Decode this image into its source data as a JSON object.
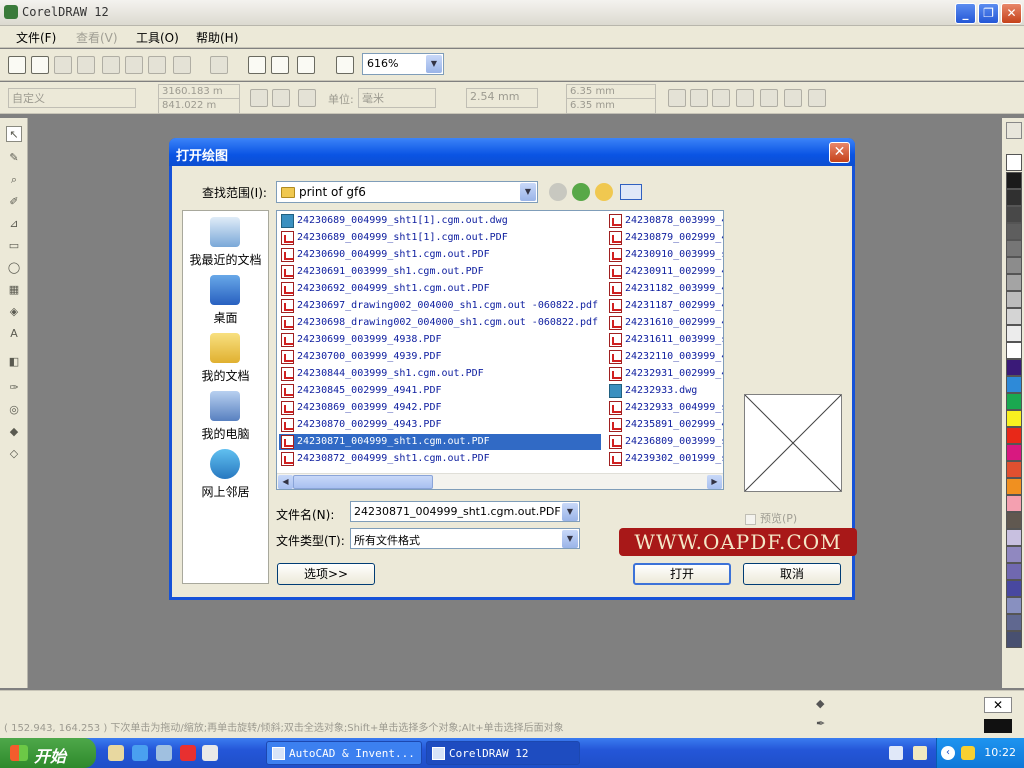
{
  "app": {
    "title": "CorelDRAW 12"
  },
  "menu": [
    "文件(F)",
    "查看(V)",
    "工具(O)",
    "帮助(H)"
  ],
  "toolbar": {
    "zoom": "616%"
  },
  "propbar": {
    "preset": "自定义",
    "width": "3160.183 m",
    "height": "841.022 m",
    "unit_label": "单位:",
    "unit": "毫米",
    "nudge": "2.54 mm",
    "dup_x": "6.35 mm",
    "dup_y": "6.35 mm"
  },
  "status": {
    "text": "( 152.943, 164.253 )  下次单击为拖动/缩放;再单击旋转/倾斜;双击全选对象;Shift+单击选择多个对象;Alt+单击选择后面对象"
  },
  "dialog": {
    "title": "打开绘图",
    "lookin_label": "查找范围(I):",
    "lookin_value": "print of gf6",
    "places": [
      "我最近的文档",
      "桌面",
      "我的文档",
      "我的电脑",
      "网上邻居"
    ],
    "files_col1": [
      {
        "name": "24230689_004999_sht1[1].cgm.out.dwg",
        "type": "dwg"
      },
      {
        "name": "24230689_004999_sht1[1].cgm.out.PDF",
        "type": "pdf"
      },
      {
        "name": "24230690_004999_sht1.cgm.out.PDF",
        "type": "pdf"
      },
      {
        "name": "24230691_003999_sh1.cgm.out.PDF",
        "type": "pdf"
      },
      {
        "name": "24230692_004999_sht1.cgm.out.PDF",
        "type": "pdf"
      },
      {
        "name": "24230697_drawing002_004000_sh1.cgm.out -060822.pdf",
        "type": "pdf"
      },
      {
        "name": "24230698_drawing002_004000_sh1.cgm.out -060822.pdf",
        "type": "pdf"
      },
      {
        "name": "24230699_003999_4938.PDF",
        "type": "pdf"
      },
      {
        "name": "24230700_003999_4939.PDF",
        "type": "pdf"
      },
      {
        "name": "24230844_003999_sh1.cgm.out.PDF",
        "type": "pdf"
      },
      {
        "name": "24230845_002999_4941.PDF",
        "type": "pdf"
      },
      {
        "name": "24230869_003999_4942.PDF",
        "type": "pdf"
      },
      {
        "name": "24230870_002999_4943.PDF",
        "type": "pdf"
      },
      {
        "name": "24230871_004999_sht1.cgm.out.PDF",
        "type": "pdf",
        "selected": true
      },
      {
        "name": "24230872_004999_sht1.cgm.out.PDF",
        "type": "pdf"
      }
    ],
    "files_col2": [
      {
        "name": "24230878_003999_4",
        "type": "pdf"
      },
      {
        "name": "24230879_002999_4",
        "type": "pdf"
      },
      {
        "name": "24230910_003999_s",
        "type": "pdf"
      },
      {
        "name": "24230911_002999_4",
        "type": "pdf"
      },
      {
        "name": "24231182_003999_4",
        "type": "pdf"
      },
      {
        "name": "24231187_002999_4",
        "type": "pdf"
      },
      {
        "name": "24231610_002999_4",
        "type": "pdf"
      },
      {
        "name": "24231611_003999_s",
        "type": "pdf"
      },
      {
        "name": "24232110_003999_4",
        "type": "pdf"
      },
      {
        "name": "24232931_002999_4",
        "type": "pdf"
      },
      {
        "name": "24232933.dwg",
        "type": "dwg"
      },
      {
        "name": "24232933_004999_s",
        "type": "pdf"
      },
      {
        "name": "24235891_002999_4",
        "type": "pdf"
      },
      {
        "name": "24236809_003999_s",
        "type": "pdf"
      },
      {
        "name": "24239302_001999_s",
        "type": "pdf"
      }
    ],
    "filename_label": "文件名(N):",
    "filename_value": "24230871_004999_sht1.cgm.out.PDF",
    "filetype_label": "文件类型(T):",
    "filetype_value": "所有文件格式",
    "preview_label": "预览(P)",
    "options_button": "选项>>",
    "open_button": "打开",
    "cancel_button": "取消",
    "watermark": "WWW.OAPDF.COM"
  },
  "taskbar": {
    "start": "开始",
    "tasks": [
      "AutoCAD & Invent...",
      "CorelDRAW 12"
    ],
    "clock": "10:22"
  },
  "colors": {
    "accent": "#0a54e4",
    "selection": "#316ac5",
    "watermark_bg": "#a81818"
  }
}
